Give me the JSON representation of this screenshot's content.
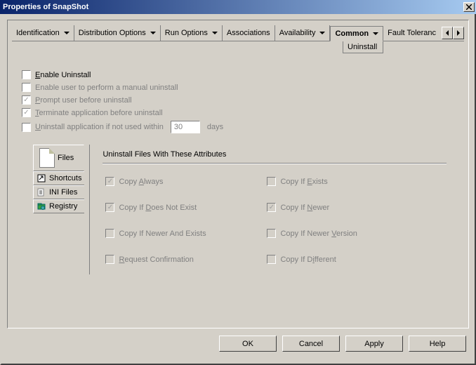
{
  "title": "Properties of SnapShot",
  "tabs": [
    "Identification",
    "Distribution Options",
    "Run Options",
    "Associations",
    "Availability",
    "Common",
    "Fault Toleranc"
  ],
  "active_tab": "Common",
  "submenu": "Uninstall",
  "options": {
    "enable_uninstall": {
      "label_pre": "",
      "u": "E",
      "label_post": "nable Uninstall",
      "checked": false,
      "disabled": false
    },
    "enable_manual": {
      "label": "Enable user to perform a manual uninstall",
      "checked": false,
      "disabled": true
    },
    "prompt_before": {
      "label_pre": "",
      "u": "P",
      "label_post": "rompt user before uninstall",
      "checked": true,
      "disabled": true
    },
    "terminate_before": {
      "label_pre": "",
      "u": "T",
      "label_post": "erminate application before uninstall",
      "checked": true,
      "disabled": true
    },
    "uninstall_days": {
      "label_pre": "",
      "u": "U",
      "label_post": "ninstall application if not used within",
      "checked": false,
      "disabled": true,
      "value": "30",
      "suffix": "days"
    }
  },
  "side_tabs": {
    "files": "Files",
    "shortcuts": "Shortcuts",
    "ini": "INI Files",
    "registry": "Registry"
  },
  "attributes": {
    "title": "Uninstall Files With These Attributes",
    "items": [
      {
        "u": "A",
        "label": "Copy Always",
        "checked": true
      },
      {
        "label_pre": "Copy If ",
        "u": "E",
        "label_post": "xists",
        "checked": false
      },
      {
        "label_pre": "Copy If ",
        "u": "D",
        "label_post": "oes Not Exist",
        "checked": true
      },
      {
        "label_pre": "Copy If ",
        "u": "N",
        "label_post": "ewer",
        "checked": true
      },
      {
        "label": "Copy If Newer And Exists",
        "checked": false
      },
      {
        "label_pre": "Copy If Newer ",
        "u": "V",
        "label_post": "ersion",
        "checked": false
      },
      {
        "label_pre": "",
        "u": "R",
        "label_post": "equest Confirmation",
        "checked": false
      },
      {
        "label_pre": "Copy If D",
        "u": "i",
        "label_post": "fferent",
        "checked": false
      }
    ]
  },
  "buttons": {
    "ok": "OK",
    "cancel": "Cancel",
    "apply": "Apply",
    "help": "Help"
  }
}
